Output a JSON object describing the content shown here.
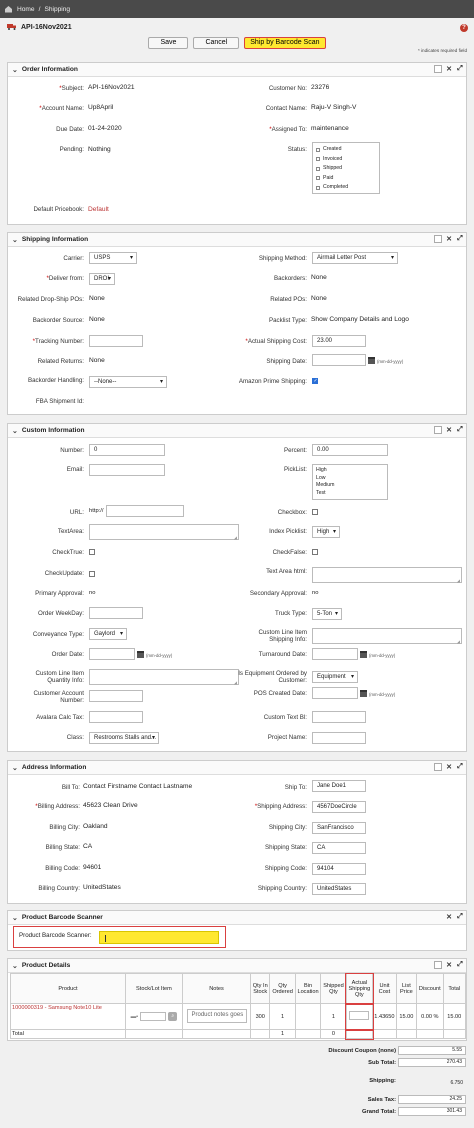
{
  "nav": {
    "home": "Home",
    "sep": "/",
    "section": "Shipping"
  },
  "record": {
    "title": "API-16Nov2021"
  },
  "toolbar": {
    "save": "Save",
    "cancel": "Cancel",
    "barcode": "Ship by Barcode Scan"
  },
  "required_note": "* indicates required field",
  "order_info": {
    "header": "Order Information",
    "subject_label": "Subject:",
    "subject": "API-16Nov2021",
    "account_label": "Account Name:",
    "account": "Up8April",
    "due_label": "Due Date:",
    "due": "01-24-2020",
    "pending_label": "Pending:",
    "pending": "Nothing",
    "pricebook_label": "Default Pricebook:",
    "pricebook": "Default",
    "customer_no_label": "Customer No:",
    "customer_no": "23276",
    "contact_label": "Contact Name:",
    "contact": "Raju-V Singh-V",
    "assigned_label": "Assigned To:",
    "assigned": "maintenance",
    "status_label": "Status:",
    "status_options": [
      "Created",
      "Invoiced",
      "Shipped",
      "Paid",
      "Completed"
    ]
  },
  "shipping_info": {
    "header": "Shipping Information",
    "carrier_label": "Carrier:",
    "carrier": "USPS",
    "deliver_label": "Deliver from:",
    "deliver": "DROI",
    "related_dropship_label": "Related Drop-Ship POs:",
    "related_dropship": "None",
    "backorder_source_label": "Backorder Source:",
    "backorder_source": "None",
    "tracking_label": "Tracking Number:",
    "tracking": "",
    "related_returns_label": "Related Returns:",
    "related_returns": "None",
    "backorder_handling_label": "Backorder Handling:",
    "backorder_handling": "--None--",
    "fba_label": "FBA Shipment Id:",
    "method_label": "Shipping Method:",
    "method": "Airmail Letter Post",
    "backorders_label": "Backorders:",
    "backorders": "None",
    "related_pos_label": "Related POs:",
    "related_pos": "None",
    "packlist_label": "Packlist Type:",
    "packlist": "Show Company Details and Logo",
    "actual_cost_label": "Actual Shipping Cost:",
    "actual_cost": "23.00",
    "ship_date_label": "Shipping Date:",
    "date_hint": "(mm-dd-yyyy)",
    "amazon_label": "Amazon Prime Shipping:"
  },
  "custom_info": {
    "header": "Custom Information",
    "number_label": "Number:",
    "number": "0",
    "email_label": "Email:",
    "url_label": "URL:",
    "url_prefix": "http://",
    "textarea_label": "TextArea:",
    "checktrue_label": "CheckTrue:",
    "checkupdate_label": "CheckUpdate:",
    "primary_approval_label": "Primary Approval:",
    "primary_approval": "no",
    "order_weekday_label": "Order WeekDay:",
    "conveyance_label": "Conveyance Type:",
    "conveyance": "Gaylord",
    "order_date_label": "Order Date:",
    "line_item_qty_label": "Custom Line Item Quantity Info:",
    "customer_account_label": "Customer Account Number:",
    "avalara_label": "Avalara Calc Tax:",
    "class_label": "Class:",
    "class_value": "Restrooms Stalls and...",
    "percent_label": "Percent:",
    "percent": "0.00",
    "picklist_label": "PickList:",
    "picklist_options": [
      "High",
      "Low",
      "Medium",
      "Test"
    ],
    "checkbox_label": "Checkbox:",
    "index_picklist_label": "Index Picklist:",
    "index_picklist": "High",
    "checkfalse_label": "CheckFalse:",
    "textarea_html_label": "Text Area html:",
    "secondary_approval_label": "Secondary Approval:",
    "secondary_approval": "no",
    "truck_label": "Truck Type:",
    "truck": "5-Ton",
    "custom_line_shipping_label": "Custom Line Item Shipping Info:",
    "turnaround_label": "Turnaround Date:",
    "equipment_label": "Is Equipment Ordered by Customer:",
    "equipment": "Equipment",
    "pos_created_label": "POS Created Date:",
    "custom_text_label": "Custom Text Bl:",
    "project_name_label": "Project Name:",
    "date_hint": "(mm-dd-yyyy)"
  },
  "address_info": {
    "header": "Address Information",
    "bill_to_label": "Bill To:",
    "bill_to": "Contact Firstname Contact Lastname",
    "billing_address_label": "Billing Address:",
    "billing_address": "45623 Clean Drive",
    "billing_city_label": "Billing City:",
    "billing_city": "Oakland",
    "billing_state_label": "Billing State:",
    "billing_state": "CA",
    "billing_code_label": "Billing Code:",
    "billing_code": "94601",
    "billing_country_label": "Billing Country:",
    "billing_country": "UnitedStates",
    "ship_to_label": "Ship To:",
    "ship_to": "Jane Doe1",
    "shipping_address_label": "Shipping Address:",
    "shipping_address": "4567DoeCircle",
    "shipping_city_label": "Shipping City:",
    "shipping_city": "SanFrancisco",
    "shipping_state_label": "Shipping State:",
    "shipping_state": "CA",
    "shipping_code_label": "Shipping Code:",
    "shipping_code": "94104",
    "shipping_country_label": "Shipping Country:",
    "shipping_country": "UnitedStates"
  },
  "barcode_panel": {
    "header": "Product Barcode Scanner",
    "label": "Product Barcode Scanner:"
  },
  "product_details": {
    "header": "Product Details",
    "columns": [
      "Product",
      "Stock/Lot Item",
      "Notes",
      "Qty In Stock",
      "Qty Ordered",
      "Bin Location",
      "Shipped Qty",
      "Actual Shipping Qty",
      "Unit Cost",
      "List Price",
      "Discount",
      "Total"
    ],
    "row": {
      "product": "1000000319 - Samsung Note10 Lite",
      "notes_placeholder": "Product notes goes",
      "qty_in_stock": "300",
      "qty_ordered": "1",
      "shipped_qty": "1",
      "unit_cost": "1.43650",
      "list_price": "15.00",
      "discount": "0.00 %",
      "total": "15.00"
    },
    "total_row": {
      "label": "Total",
      "qty_ordered": "1",
      "shipped_qty": "0"
    }
  },
  "summary": {
    "discount_label": "Discount Coupon (none)",
    "discount": "5.55",
    "subtotal_label": "Sub Total:",
    "subtotal": "270.43",
    "shipping_label": "Shipping:",
    "shipping": "6.750",
    "sales_tax_label": "Sales Tax:",
    "sales_tax": "24.25",
    "grand_total_label": "Grand Total:",
    "grand_total": "301.43"
  },
  "colors": {
    "accent_button": "#ffe830",
    "highlight_border": "#d94040",
    "link": "#b33333",
    "nav_bg": "#4a4a4a"
  }
}
